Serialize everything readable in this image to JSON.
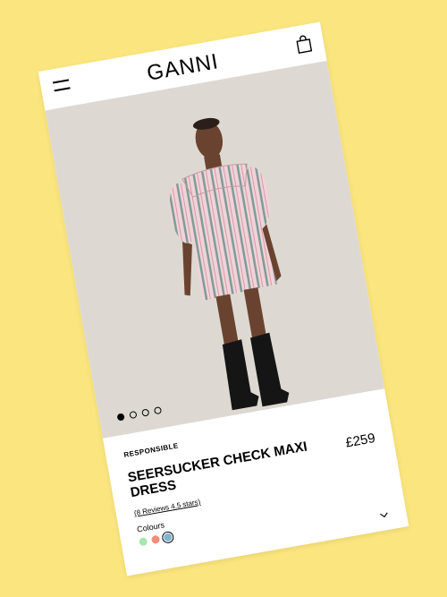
{
  "header": {
    "brand": "GANNI",
    "menu_icon": "hamburger-menu-icon",
    "bag_icon": "shopping-bag-icon"
  },
  "gallery": {
    "image_count": 4,
    "active_index": 0
  },
  "product": {
    "tag": "RESPONSIBLE",
    "name": "SEERSUCKER CHECK MAXI DRESS",
    "price": "£259",
    "reviews": "(8 Reviews 4.5 stars)",
    "colours_label": "Colours",
    "colours": [
      "#a8e6b0",
      "#f08c7c",
      "#7fb6d3"
    ],
    "selected_colour_index": 2,
    "expand_icon": "chevron-down-icon"
  },
  "colors": {
    "background": "#fbe57e",
    "card": "#ffffff",
    "photo_backdrop": "#ddd9d2"
  }
}
